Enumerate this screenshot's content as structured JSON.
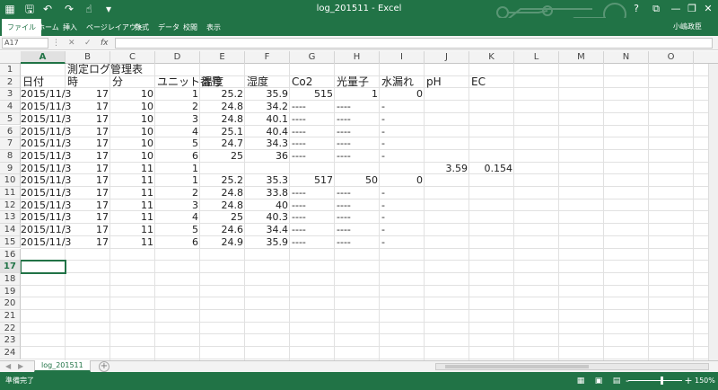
{
  "window": {
    "title": "log_201511 - Excel",
    "controls": {
      "help": "?",
      "ribbon_display": "⧉",
      "minimize": "—",
      "restore": "❐",
      "close": "✕"
    }
  },
  "quick_access": [
    "save-icon",
    "undo-icon",
    "redo-icon",
    "touch-mode-icon",
    "customize-icon"
  ],
  "ribbon": {
    "tabs": [
      "ファイル",
      "ホーム",
      "挿入",
      "ページレイアウト",
      "数式",
      "データ",
      "校閲",
      "表示"
    ],
    "active_tab": "ファイル",
    "user": "小嶋政臣"
  },
  "formula_bar": {
    "name_box": "A17",
    "formula": ""
  },
  "sheet": {
    "columns": [
      "A",
      "B",
      "C",
      "D",
      "E",
      "F",
      "G",
      "H",
      "I",
      "J",
      "K",
      "L",
      "M",
      "N",
      "O"
    ],
    "rows": [
      "1",
      "2",
      "3",
      "4",
      "5",
      "6",
      "7",
      "8",
      "9",
      "10",
      "11",
      "12",
      "13",
      "14",
      "15",
      "16",
      "17",
      "18",
      "19",
      "20",
      "21",
      "22",
      "23",
      "24"
    ],
    "selected_cell": "A17",
    "selected_col": "A",
    "selected_row": "17",
    "title_text": "測定ログ管理表",
    "headers": [
      "日付",
      "時",
      "分",
      "ユニット番号",
      "温度",
      "湿度",
      "Co2",
      "光量子",
      "水漏れ",
      "pH",
      "EC"
    ],
    "data": [
      [
        "2015/11/3",
        "17",
        "10",
        "1",
        "25.2",
        "35.9",
        "515",
        "1",
        "0",
        "",
        ""
      ],
      [
        "2015/11/3",
        "17",
        "10",
        "2",
        "24.8",
        "34.2",
        "----",
        "----",
        "-",
        "",
        ""
      ],
      [
        "2015/11/3",
        "17",
        "10",
        "3",
        "24.8",
        "40.1",
        "----",
        "----",
        "-",
        "",
        ""
      ],
      [
        "2015/11/3",
        "17",
        "10",
        "4",
        "25.1",
        "40.4",
        "----",
        "----",
        "-",
        "",
        ""
      ],
      [
        "2015/11/3",
        "17",
        "10",
        "5",
        "24.7",
        "34.3",
        "----",
        "----",
        "-",
        "",
        ""
      ],
      [
        "2015/11/3",
        "17",
        "10",
        "6",
        "25",
        "36",
        "----",
        "----",
        "-",
        "",
        ""
      ],
      [
        "2015/11/3",
        "17",
        "11",
        "1",
        "",
        "",
        "",
        "",
        "",
        "3.59",
        "0.154"
      ],
      [
        "2015/11/3",
        "17",
        "11",
        "1",
        "25.2",
        "35.3",
        "517",
        "50",
        "0",
        "",
        ""
      ],
      [
        "2015/11/3",
        "17",
        "11",
        "2",
        "24.8",
        "33.8",
        "----",
        "----",
        "-",
        "",
        ""
      ],
      [
        "2015/11/3",
        "17",
        "11",
        "3",
        "24.8",
        "40",
        "----",
        "----",
        "-",
        "",
        ""
      ],
      [
        "2015/11/3",
        "17",
        "11",
        "4",
        "25",
        "40.3",
        "----",
        "----",
        "-",
        "",
        ""
      ],
      [
        "2015/11/3",
        "17",
        "11",
        "5",
        "24.6",
        "34.4",
        "----",
        "----",
        "-",
        "",
        ""
      ],
      [
        "2015/11/3",
        "17",
        "11",
        "6",
        "24.9",
        "35.9",
        "----",
        "----",
        "-",
        "",
        ""
      ]
    ]
  },
  "sheet_tabs": [
    "log_201511"
  ],
  "add_sheet": "+",
  "status": {
    "ready": "準備完了",
    "zoom": "150%",
    "zoom_minus": "-",
    "zoom_plus": "+"
  },
  "colors": {
    "accent": "#217346"
  }
}
